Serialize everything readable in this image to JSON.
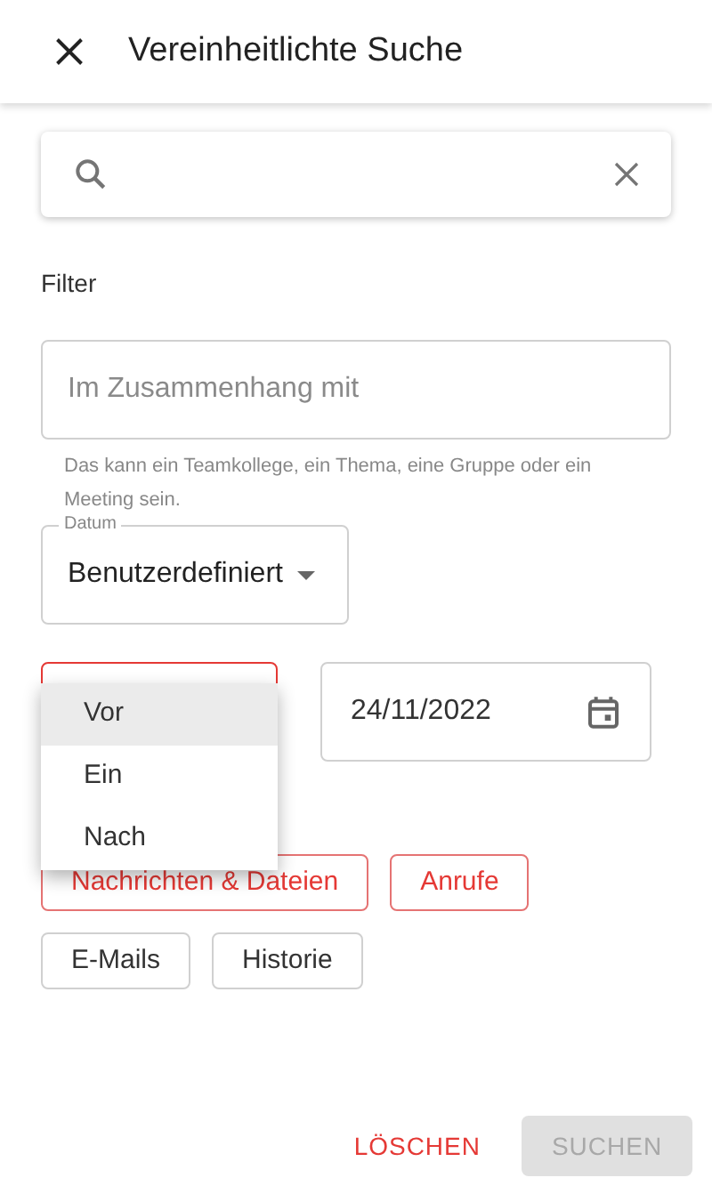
{
  "header": {
    "title": "Vereinheitlichte Suche"
  },
  "filter": {
    "label": "Filter",
    "related_field": {
      "placeholder": "Im Zusammenhang mit",
      "helper": "Das kann ein Teamkollege, ein Thema, eine Gruppe oder ein Meeting sein."
    },
    "date_select": {
      "label": "Datum",
      "value": "Benutzerdefiniert"
    },
    "relation_select": {
      "focused": true,
      "menu": [
        {
          "label": "Vor",
          "selected": true
        },
        {
          "label": "Ein",
          "selected": false
        },
        {
          "label": "Nach",
          "selected": false
        }
      ]
    },
    "date_field": {
      "value": "24/11/2022"
    },
    "chips": [
      {
        "label": "Nachrichten & Dateien",
        "selected": true
      },
      {
        "label": "Anrufe",
        "selected": true
      },
      {
        "label": "E-Mails",
        "selected": false
      },
      {
        "label": "Historie",
        "selected": false
      }
    ]
  },
  "actions": [
    {
      "label": "LÖSCHEN",
      "disabled": false
    },
    {
      "label": "SUCHEN",
      "disabled": true
    }
  ]
}
